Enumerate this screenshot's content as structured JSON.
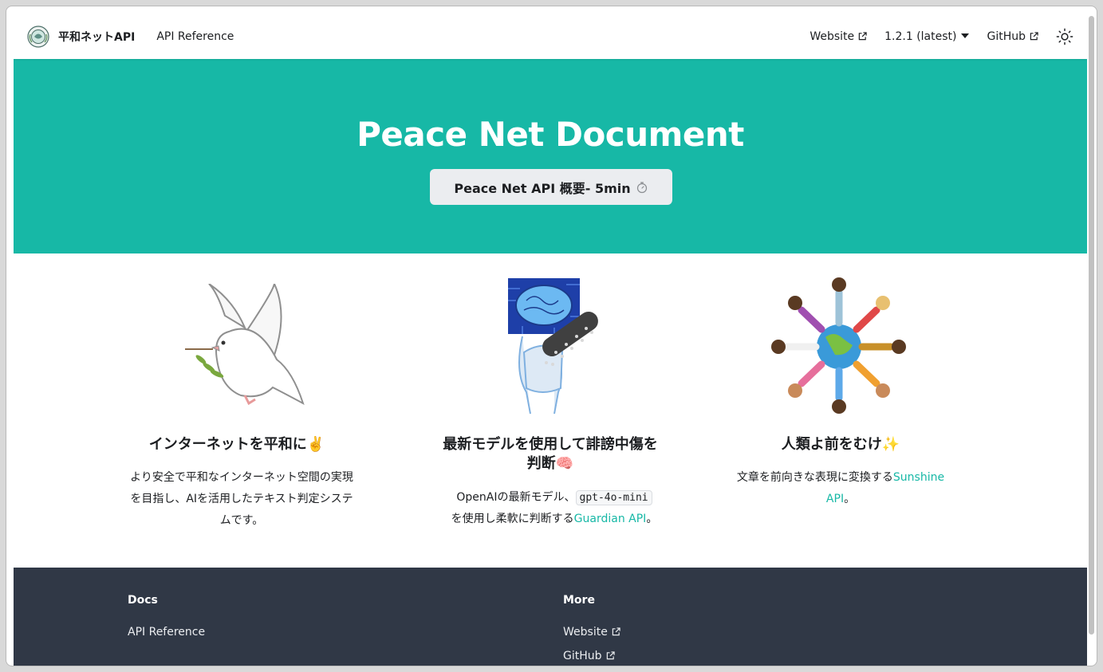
{
  "navbar": {
    "brand_title": "平和ネットAPI",
    "api_reference": "API Reference",
    "website": "Website",
    "version": "1.2.1 (latest)",
    "github": "GitHub",
    "theme_icon": "sun-icon"
  },
  "hero": {
    "title": "Peace Net Document",
    "button_label": "Peace Net API 概要- 5min",
    "button_icon": "stopwatch-icon"
  },
  "features": [
    {
      "title": "インターネットを平和に✌️",
      "description": "より安全で平和なインターネット空間の実現を目指し、AIを活用したテキスト判定システムです。",
      "image": "dove-illustration"
    },
    {
      "title_line1": "最新モデルを使用して誹謗中傷を",
      "title_line2": "判断🧠",
      "desc_prefix": "OpenAIの最新モデル、",
      "code": "gpt-4o-mini",
      "desc_mid": "を使用し柔軟に判断する",
      "link": "Guardian API",
      "desc_suffix": "。",
      "image": "brain-robot-illustration"
    },
    {
      "title": "人類よ前をむけ✨",
      "desc_prefix": "文章を前向きな表現に変換する",
      "link_line1": "Sunshine",
      "link_line2": "API",
      "desc_suffix": "。",
      "image": "people-around-globe-illustration"
    }
  ],
  "footer": {
    "docs_title": "Docs",
    "docs_api_reference": "API Reference",
    "more_title": "More",
    "more_website": "Website",
    "more_github": "GitHub"
  },
  "colors": {
    "primary": "#17b8a6",
    "footer_bg": "#303846",
    "button_bg": "#ebedf0"
  }
}
